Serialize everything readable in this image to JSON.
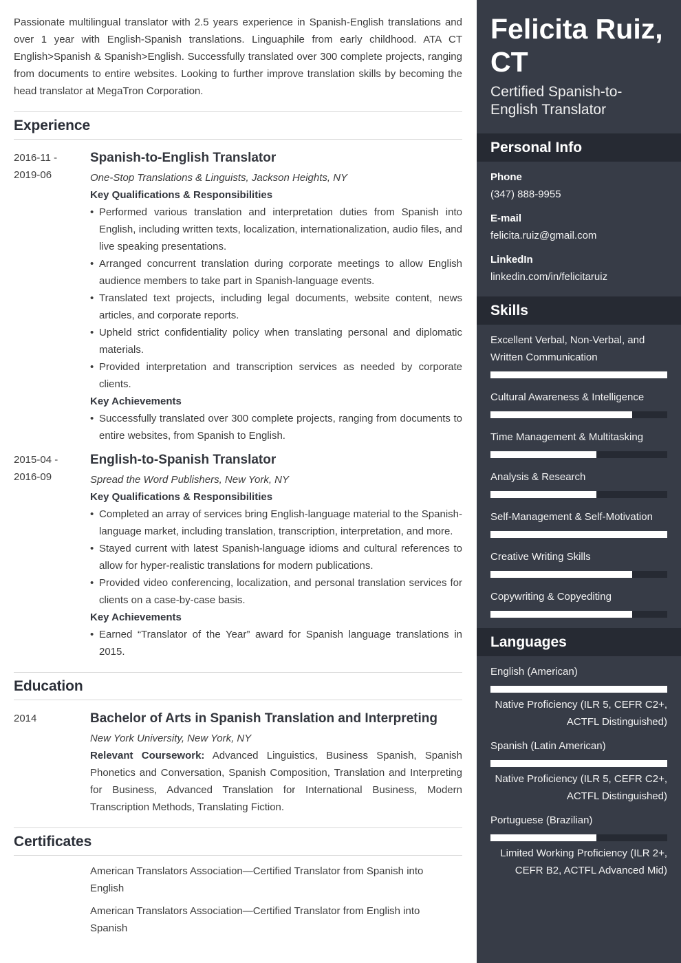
{
  "summary": "Passionate multilingual translator with 2.5 years experience in Spanish-English translations and over 1 year with English-Spanish translations. Linguaphile from early childhood. ATA CT English>Spanish & Spanish>English. Successfully translated over 300 complete projects, ranging from documents to entire websites. Looking to further improve translation skills by becoming the head translator at MegaTron Corporation.",
  "sections": {
    "experience": "Experience",
    "education": "Education",
    "certificates": "Certificates"
  },
  "experience": [
    {
      "date_start": "2016-11 -",
      "date_end": "2019-06",
      "title": "Spanish-to-English Translator",
      "org": "One-Stop Translations & Linguists, Jackson Heights, NY",
      "resp_label": "Key Qualifications & Responsibilities",
      "responsibilities": [
        "Performed various translation and interpretation duties from Spanish into English, including written texts, localization, internationalization, audio files, and live speaking presentations.",
        "Arranged concurrent translation during corporate meetings to allow English audience members to take part in Spanish-language events.",
        "Translated text projects, including legal documents, website content, news articles, and corporate reports.",
        "Upheld strict confidentiality policy when translating personal and diplomatic materials.",
        "Provided interpretation and transcription services as needed by corporate clients."
      ],
      "ach_label": "Key Achievements",
      "achievements": [
        "Successfully translated over 300 complete projects, ranging from documents to entire websites, from Spanish to English."
      ]
    },
    {
      "date_start": "2015-04 -",
      "date_end": "2016-09",
      "title": "English-to-Spanish Translator",
      "org": "Spread the Word Publishers, New York, NY",
      "resp_label": "Key Qualifications & Responsibilities",
      "responsibilities": [
        "Completed an array of services bring English-language material to the Spanish-language market, including translation, transcription, interpretation, and more.",
        "Stayed current with latest Spanish-language idioms and cultural references to allow for hyper-realistic translations for modern publications.",
        "Provided video conferencing, localization, and personal translation services for clients on a case-by-case basis."
      ],
      "ach_label": "Key Achievements",
      "achievements": [
        "Earned “Translator of the Year” award for Spanish language translations in 2015."
      ]
    }
  ],
  "education": {
    "date": "2014",
    "degree": "Bachelor of Arts in Spanish Translation and Interpreting",
    "school": "New York University, New York, NY",
    "coursework_label": "Relevant Coursework:",
    "coursework": " Advanced Linguistics, Business Spanish, Spanish Phonetics and Conversation, Spanish Composition, Translation and Interpreting for Business, Advanced Translation for International Business, Modern Transcription Methods, Translating Fiction."
  },
  "certificates": [
    "American Translators Association—Certified Translator from Spanish into English",
    "American Translators Association—Certified Translator from English into Spanish"
  ],
  "sidebar": {
    "name": "Felicita Ruiz, CT",
    "role": "Certified Spanish-to-English Translator",
    "personal_info_title": "Personal Info",
    "phone_label": "Phone",
    "phone": "(347) 888-9955",
    "email_label": "E-mail",
    "email": "felicita.ruiz@gmail.com",
    "linkedin_label": "LinkedIn",
    "linkedin": "linkedin.com/in/felicitaruiz",
    "skills_title": "Skills",
    "skills": [
      {
        "name": "Excellent Verbal, Non-Verbal, and Written Communication",
        "level": 1.0
      },
      {
        "name": "Cultural Awareness & Intelligence",
        "level": 0.8
      },
      {
        "name": "Time Management & Multitasking",
        "level": 0.6
      },
      {
        "name": "Analysis & Research",
        "level": 0.6
      },
      {
        "name": "Self-Management & Self-Motivation",
        "level": 1.0
      },
      {
        "name": "Creative Writing Skills",
        "level": 0.8
      },
      {
        "name": "Copywriting & Copyediting",
        "level": 0.8
      }
    ],
    "languages_title": "Languages",
    "languages": [
      {
        "name": "English (American)",
        "level": 1.0,
        "proficiency": "Native Proficiency (ILR 5, CEFR C2+, ACTFL Distinguished)"
      },
      {
        "name": "Spanish (Latin American)",
        "level": 1.0,
        "proficiency": "Native Proficiency (ILR 5, CEFR C2+, ACTFL Distinguished)"
      },
      {
        "name": "Portuguese (Brazilian)",
        "level": 0.6,
        "proficiency": "Limited Working Proficiency (ILR 2+, CEFR B2, ACTFL Advanced Mid)"
      }
    ]
  }
}
